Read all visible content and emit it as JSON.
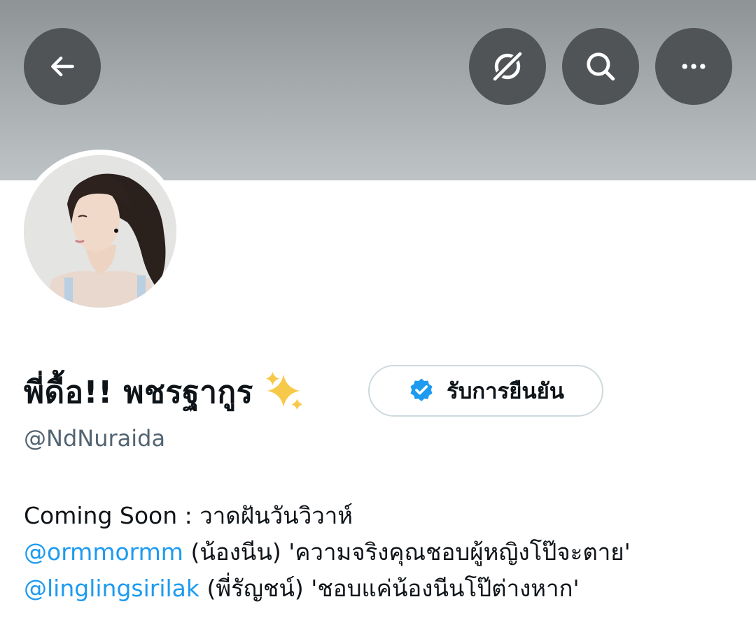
{
  "header": {
    "back_icon": "arrow-left-icon",
    "grok_icon": "grok-icon",
    "search_icon": "search-icon",
    "more_icon": "more-horizontal-icon"
  },
  "profile": {
    "display_name": "พี่ดื้อ!! พชรฐากูร",
    "name_emoji": "sparkles-emoji",
    "handle": "@NdNuraida",
    "verify_button": {
      "label": "รับการยืนยัน",
      "icon": "verified-badge-icon",
      "badge_color": "#1d9bf0"
    }
  },
  "bio": {
    "line1": "Coming Soon : วาดฝันวันวิวาห์",
    "line2_mention": "@ormmormm",
    "line2_text": " (น้องนีน) 'ความจริงคุณชอบผู้หญิงโป๊จะตาย'",
    "line3_mention": "@linglingsirilak",
    "line3_text": " (พี่รัญชน์) 'ชอบแค่น้องนีนโป๊ต่างหาก'"
  },
  "colors": {
    "link": "#1d9bf0",
    "text": "#0f1419",
    "secondary_text": "#536471",
    "header_button_bg": "#505456"
  }
}
